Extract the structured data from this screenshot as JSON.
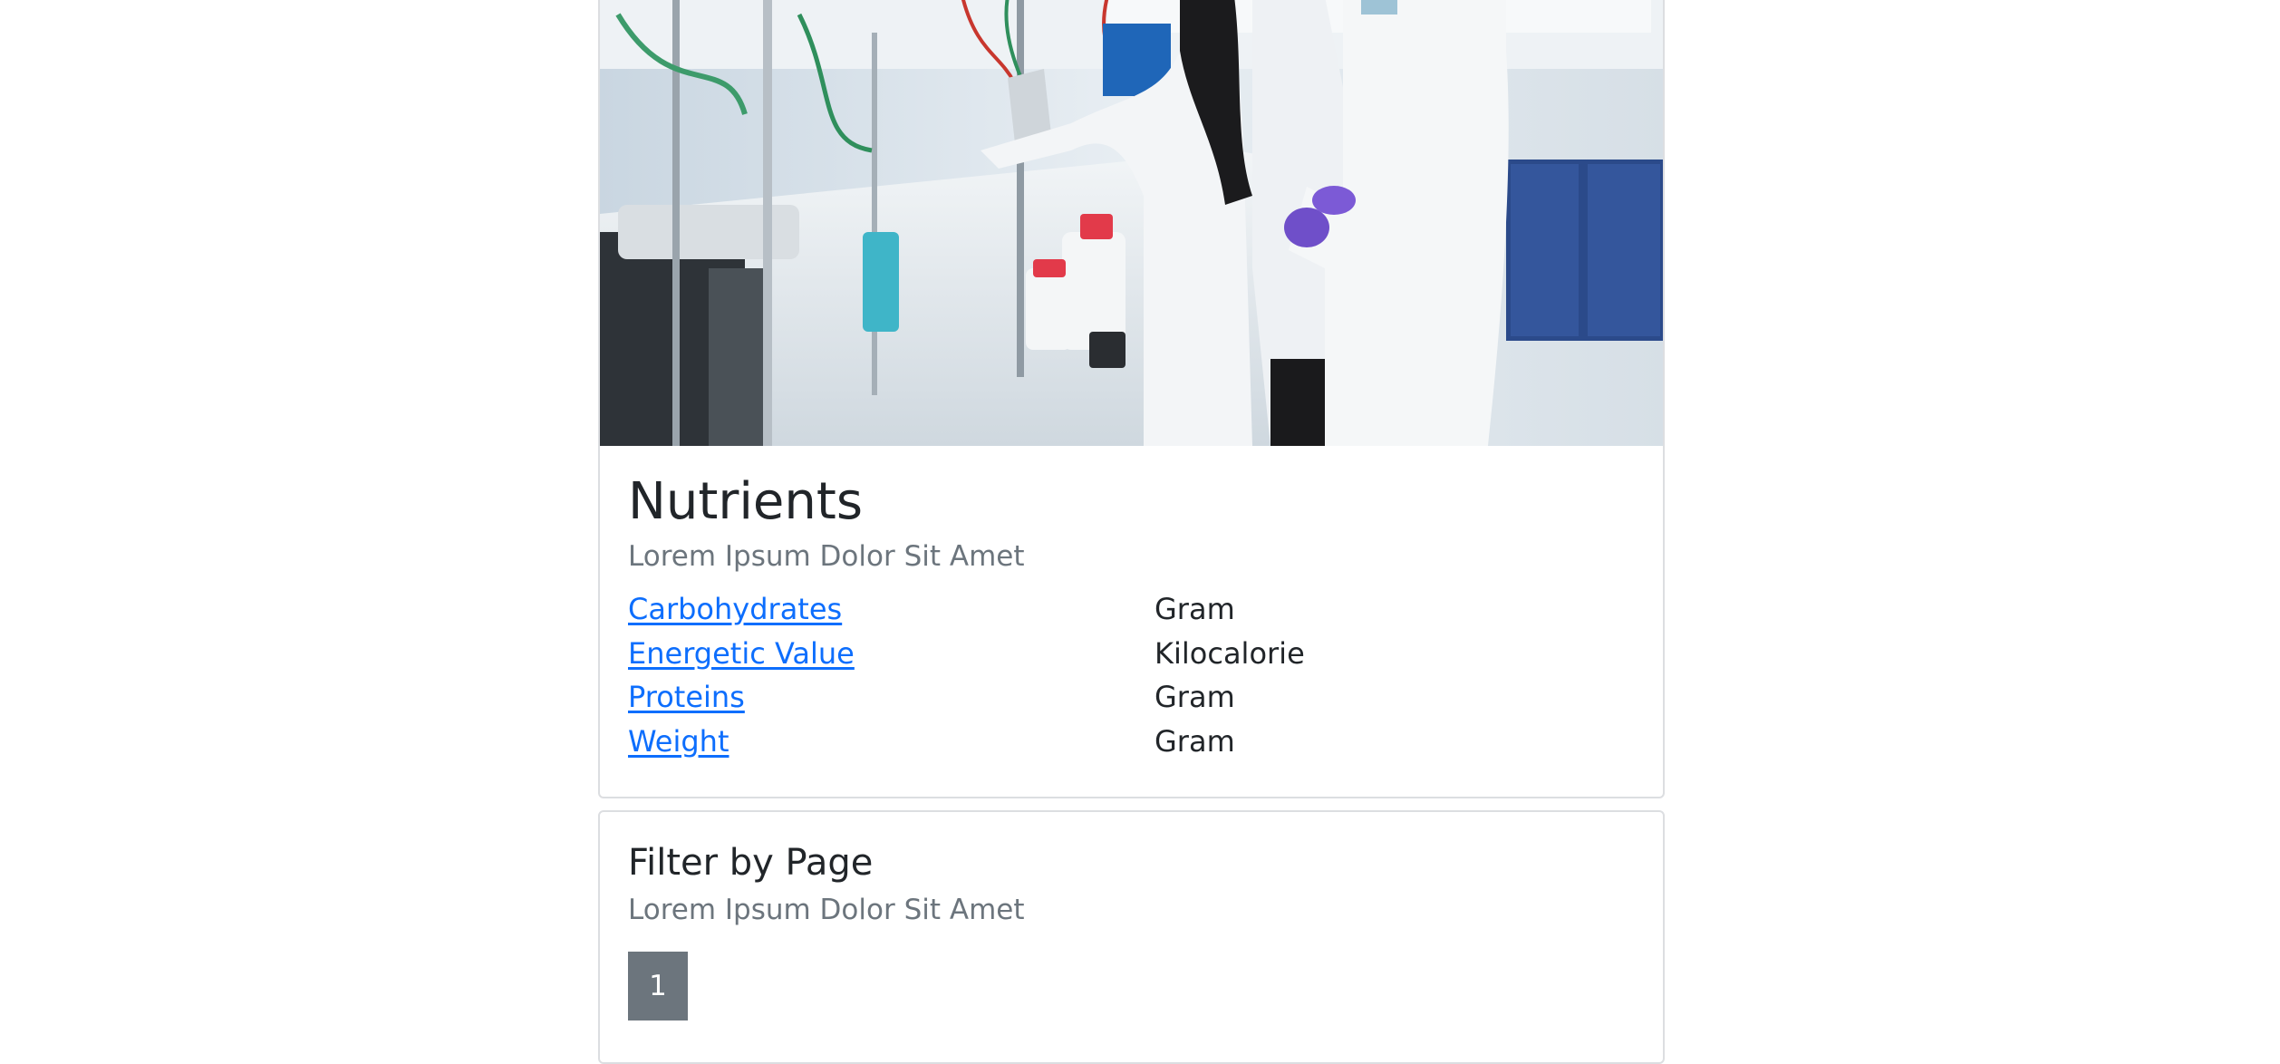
{
  "nutrients_card": {
    "image_alt": "Scientists working in a laboratory",
    "title": "Nutrients",
    "subtitle": "Lorem Ipsum Dolor Sit Amet",
    "items": [
      {
        "name": "Carbohydrates",
        "unit": "Gram"
      },
      {
        "name": "Energetic Value",
        "unit": "Kilocalorie"
      },
      {
        "name": "Proteins",
        "unit": "Gram"
      },
      {
        "name": "Weight",
        "unit": "Gram"
      }
    ]
  },
  "filter_card": {
    "title": "Filter by Page",
    "subtitle": "Lorem Ipsum Dolor Sit Amet",
    "pages": [
      "1"
    ]
  },
  "colors": {
    "link": "#0d6efd",
    "muted": "#6c757d",
    "page_button_bg": "#6c757d",
    "border": "#dcdee1"
  }
}
